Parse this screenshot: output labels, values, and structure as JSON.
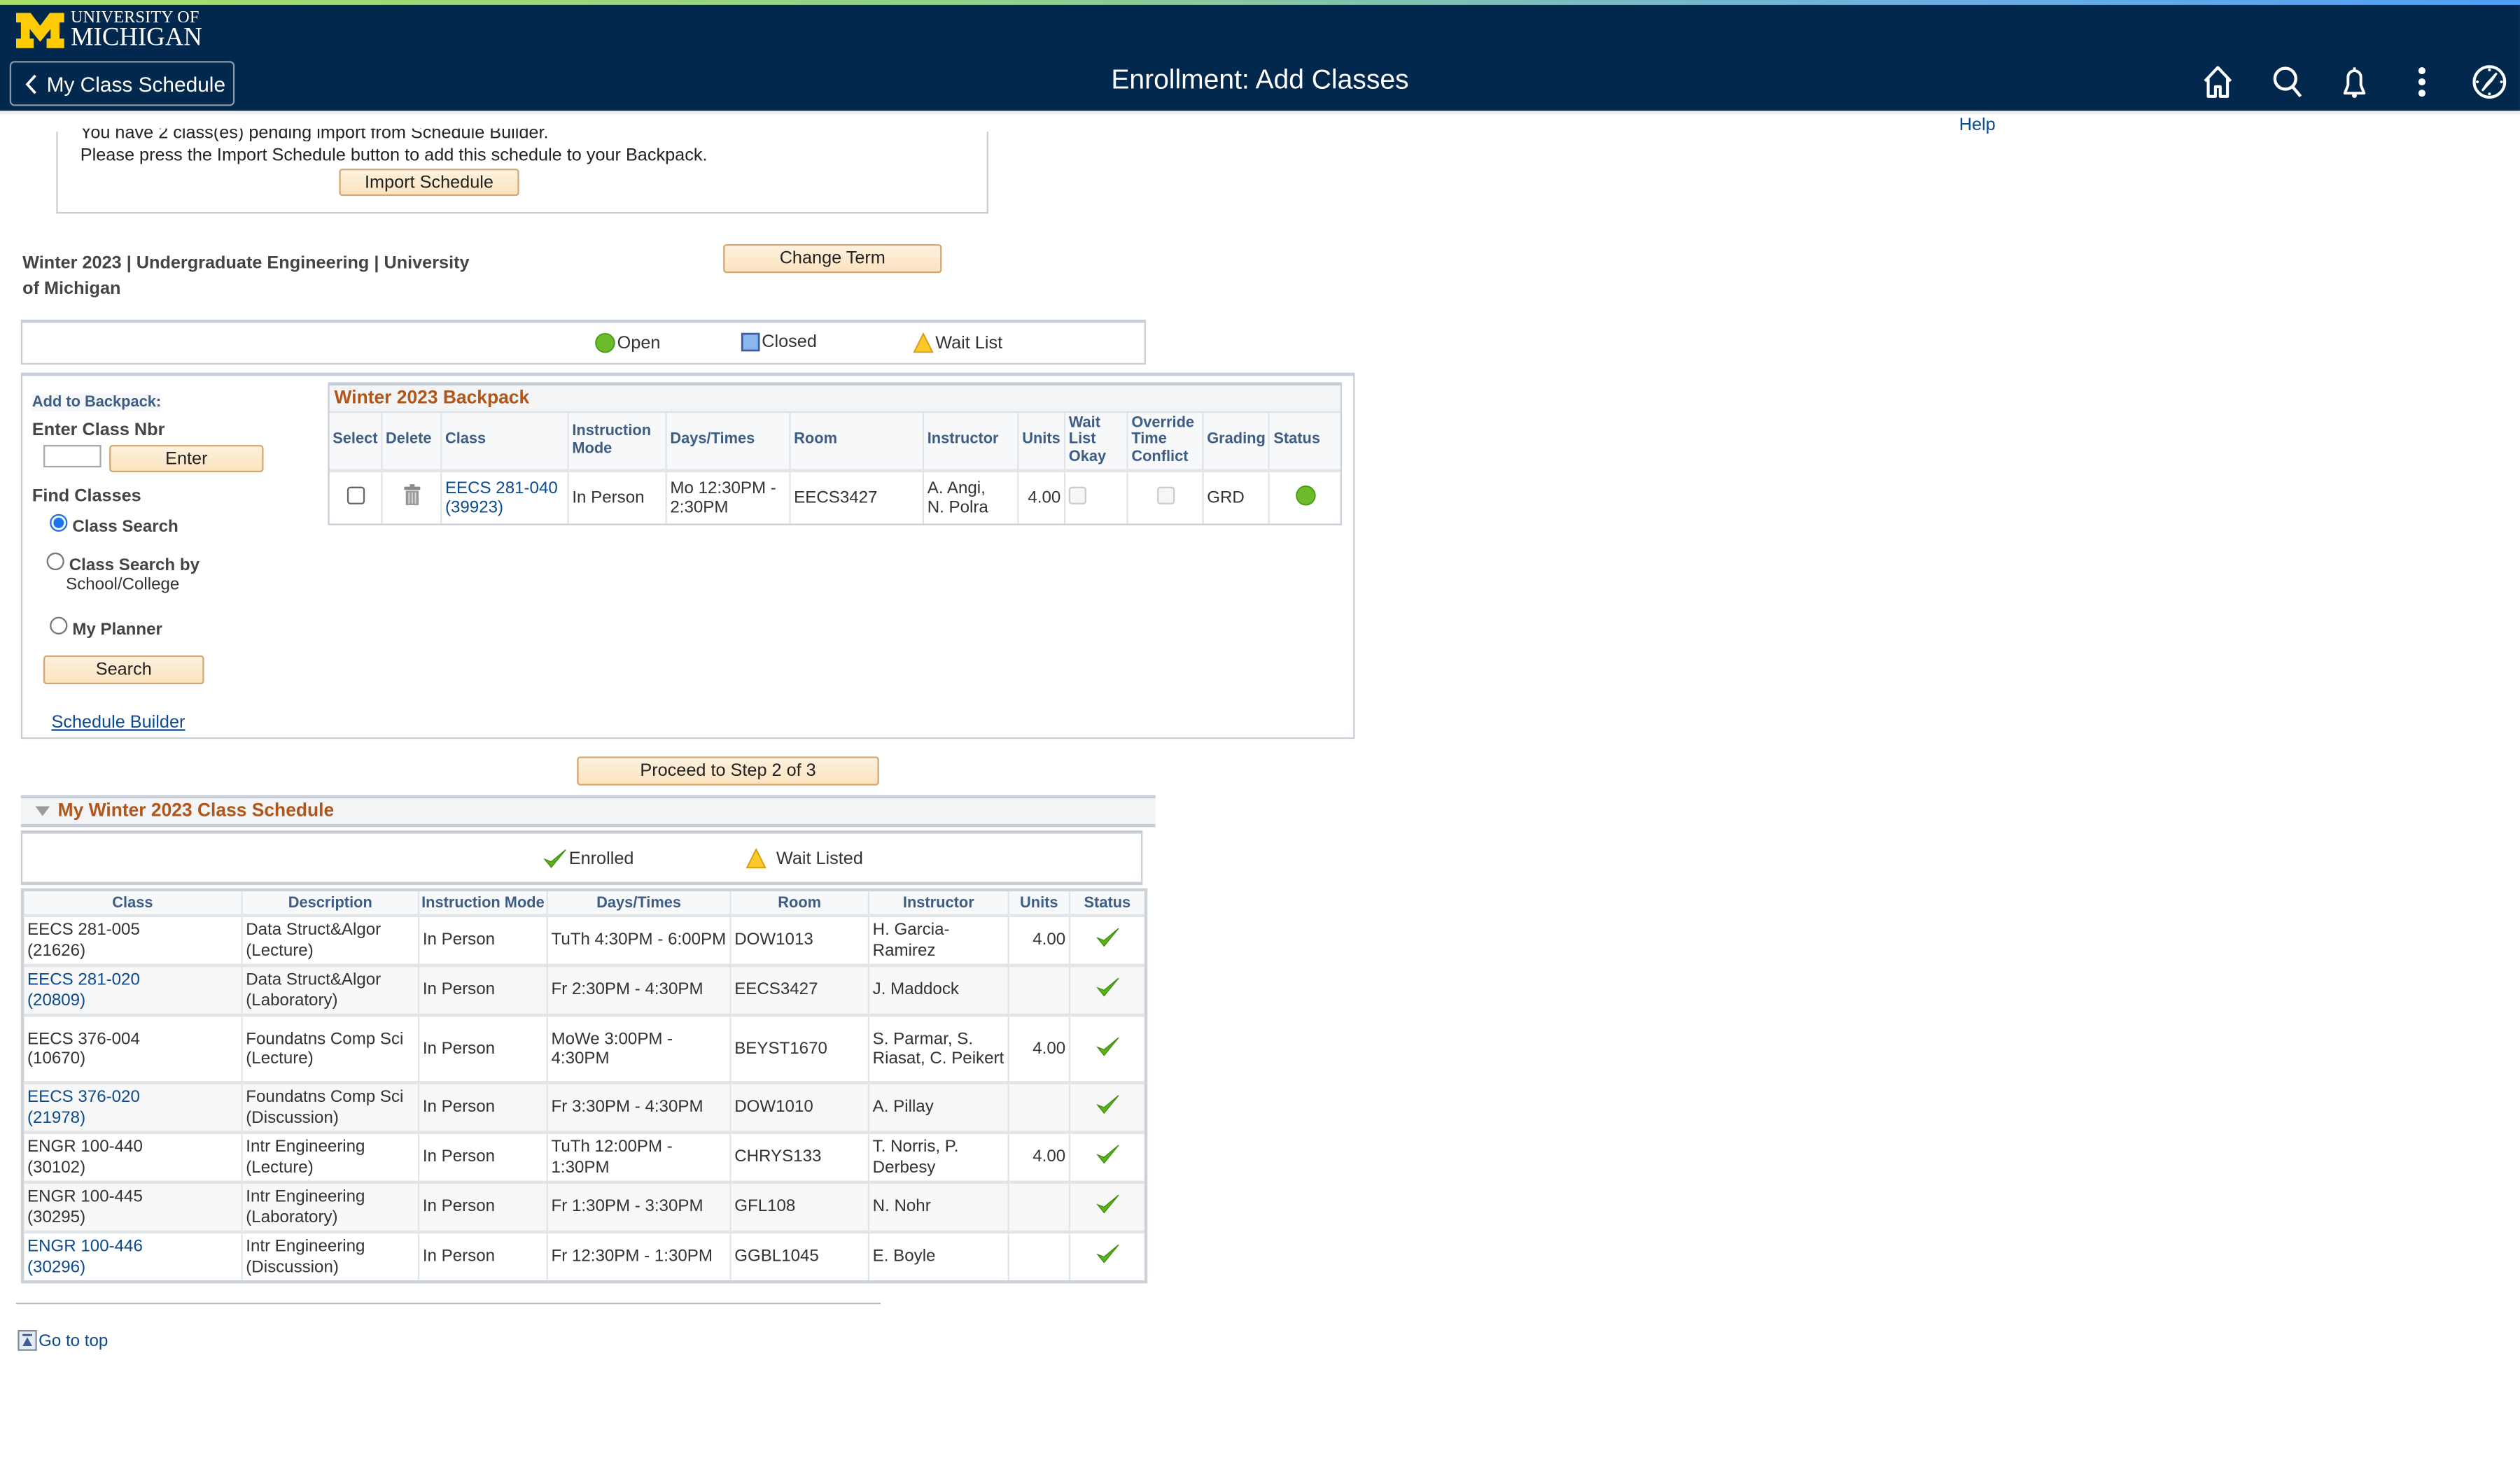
{
  "header": {
    "logo_line1": "UNIVERSITY OF",
    "logo_line2": "MICHIGAN",
    "back_label": "My Class Schedule",
    "page_title": "Enrollment: Add Classes",
    "icons": [
      "home-icon",
      "search-icon",
      "bell-icon",
      "more-vert-icon",
      "compass-icon"
    ]
  },
  "help_label": "Help",
  "import": {
    "message_line1": "You have 2 class(es) pending import from Schedule Builder.",
    "message_line2": "Please press the Import Schedule button to add this schedule to your Backpack.",
    "button_label": "Import Schedule"
  },
  "term": {
    "text": "Winter 2023 | Undergraduate Engineering | University of Michigan",
    "change_label": "Change Term"
  },
  "legend": {
    "open": "Open",
    "closed": "Closed",
    "wait_list": "Wait List"
  },
  "add_panel": {
    "title": "Add to Backpack:",
    "enter_nbr_label": "Enter Class Nbr",
    "class_nbr_value": "",
    "enter_button": "Enter",
    "find_label": "Find Classes",
    "options": [
      {
        "label": "Class Search",
        "sub": "",
        "selected": true
      },
      {
        "label": "Class Search by",
        "sub": "School/College",
        "selected": false
      },
      {
        "label": "My Planner",
        "sub": "",
        "selected": false
      }
    ],
    "search_button": "Search",
    "schedule_builder_link": "Schedule Builder"
  },
  "backpack": {
    "title": "Winter 2023 Backpack",
    "columns": [
      "Select",
      "Delete",
      "Class",
      "Instruction Mode",
      "Days/Times",
      "Room",
      "Instructor",
      "Units",
      "Wait List Okay",
      "Override Time Conflict",
      "Grading",
      "Status"
    ],
    "rows": [
      {
        "class_line1": "EECS 281-040",
        "class_line2": "(39923)",
        "mode": "In Person",
        "days_line1": "Mo 12:30PM -",
        "days_line2": "2:30PM",
        "room": "EECS3427",
        "instructor_line1": "A. Angi,",
        "instructor_line2": "N. Polra",
        "units": "4.00",
        "grading": "GRD",
        "status": "Open"
      }
    ]
  },
  "proceed_button": "Proceed to Step 2 of 3",
  "schedule": {
    "title": "My Winter 2023 Class Schedule",
    "legend_enrolled": "Enrolled",
    "legend_waitlisted": "Wait Listed",
    "columns": [
      "Class",
      "Description",
      "Instruction Mode",
      "Days/Times",
      "Room",
      "Instructor",
      "Units",
      "Status"
    ],
    "rows": [
      {
        "class1": "EECS 281-005",
        "class2": "(21626)",
        "link": false,
        "desc1": "Data Struct&Algor",
        "desc2": "(Lecture)",
        "mode": "In Person",
        "days": "TuTh 4:30PM - 6:00PM",
        "room": "DOW1013",
        "instructor": "H. Garcia-Ramirez",
        "units": "4.00",
        "status": "Enrolled"
      },
      {
        "class1": "EECS 281-020",
        "class2": "(20809)",
        "link": true,
        "desc1": "Data Struct&Algor",
        "desc2": "(Laboratory)",
        "mode": "In Person",
        "days": "Fr 2:30PM - 4:30PM",
        "room": "EECS3427",
        "instructor": "J. Maddock",
        "units": "",
        "status": "Enrolled"
      },
      {
        "class1": "EECS 376-004",
        "class2": "(10670)",
        "link": false,
        "desc1": "Foundatns Comp Sci",
        "desc2": "(Lecture)",
        "mode": "In Person",
        "days": "MoWe 3:00PM - 4:30PM",
        "room": "BEYST1670",
        "instructor": "S. Parmar, S. Riasat, C. Peikert",
        "units": "4.00",
        "status": "Enrolled"
      },
      {
        "class1": "EECS 376-020",
        "class2": "(21978)",
        "link": true,
        "desc1": "Foundatns Comp Sci",
        "desc2": "(Discussion)",
        "mode": "In Person",
        "days": "Fr 3:30PM - 4:30PM",
        "room": "DOW1010",
        "instructor": "A. Pillay",
        "units": "",
        "status": "Enrolled"
      },
      {
        "class1": "ENGR 100-440",
        "class2": "(30102)",
        "link": false,
        "desc1": "Intr Engineering",
        "desc2": "(Lecture)",
        "mode": "In Person",
        "days": "TuTh 12:00PM - 1:30PM",
        "room": "CHRYS133",
        "instructor": "T. Norris, P. Derbesy",
        "units": "4.00",
        "status": "Enrolled"
      },
      {
        "class1": "ENGR 100-445",
        "class2": "(30295)",
        "link": false,
        "desc1": "Intr Engineering",
        "desc2": "(Laboratory)",
        "mode": "In Person",
        "days": "Fr 1:30PM - 3:30PM",
        "room": "GFL108",
        "instructor": "N. Nohr",
        "units": "",
        "status": "Enrolled"
      },
      {
        "class1": "ENGR 100-446",
        "class2": "(30296)",
        "link": true,
        "desc1": "Intr Engineering",
        "desc2": "(Discussion)",
        "mode": "In Person",
        "days": "Fr 12:30PM - 1:30PM",
        "room": "GGBL1045",
        "instructor": "E. Boyle",
        "units": "",
        "status": "Enrolled"
      }
    ]
  },
  "go_to_top": "Go to top",
  "colors": {
    "header_bg": "#02284e",
    "maize": "#ffcb05",
    "section_title": "#b0561a",
    "link": "#0a4b8f",
    "open_green": "#6cbb2a",
    "button_bg": "#fbe3bf"
  }
}
